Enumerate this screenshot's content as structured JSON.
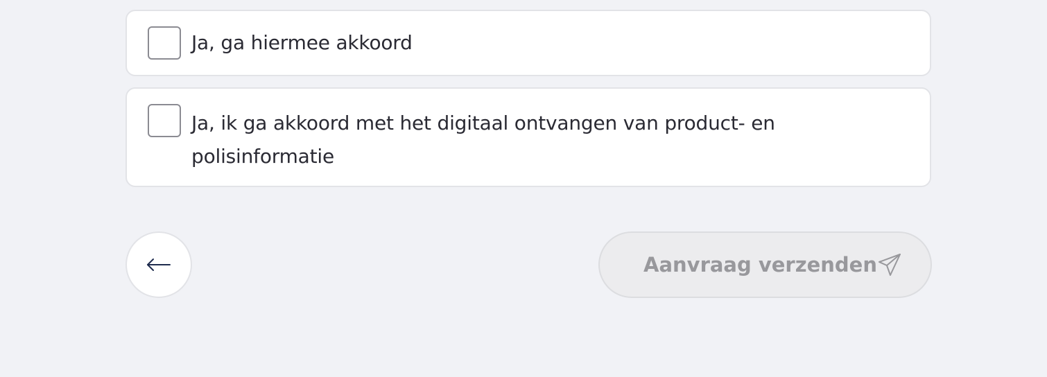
{
  "consents": [
    {
      "label": "Ja, ga hiermee akkoord",
      "checked": false
    },
    {
      "label": "Ja, ik ga akkoord met het digitaal ontvangen van product- en polisinformatie",
      "checked": false
    }
  ],
  "navigation": {
    "back_icon": "arrow-left-icon",
    "submit_label": "Aanvraag verzenden",
    "submit_icon": "paper-plane-icon",
    "submit_disabled": true
  },
  "colors": {
    "background": "#f1f2f6",
    "card": "#ffffff",
    "border": "#e2e3e7",
    "disabled_text": "#98989c",
    "back_arrow": "#1d2a4d"
  }
}
